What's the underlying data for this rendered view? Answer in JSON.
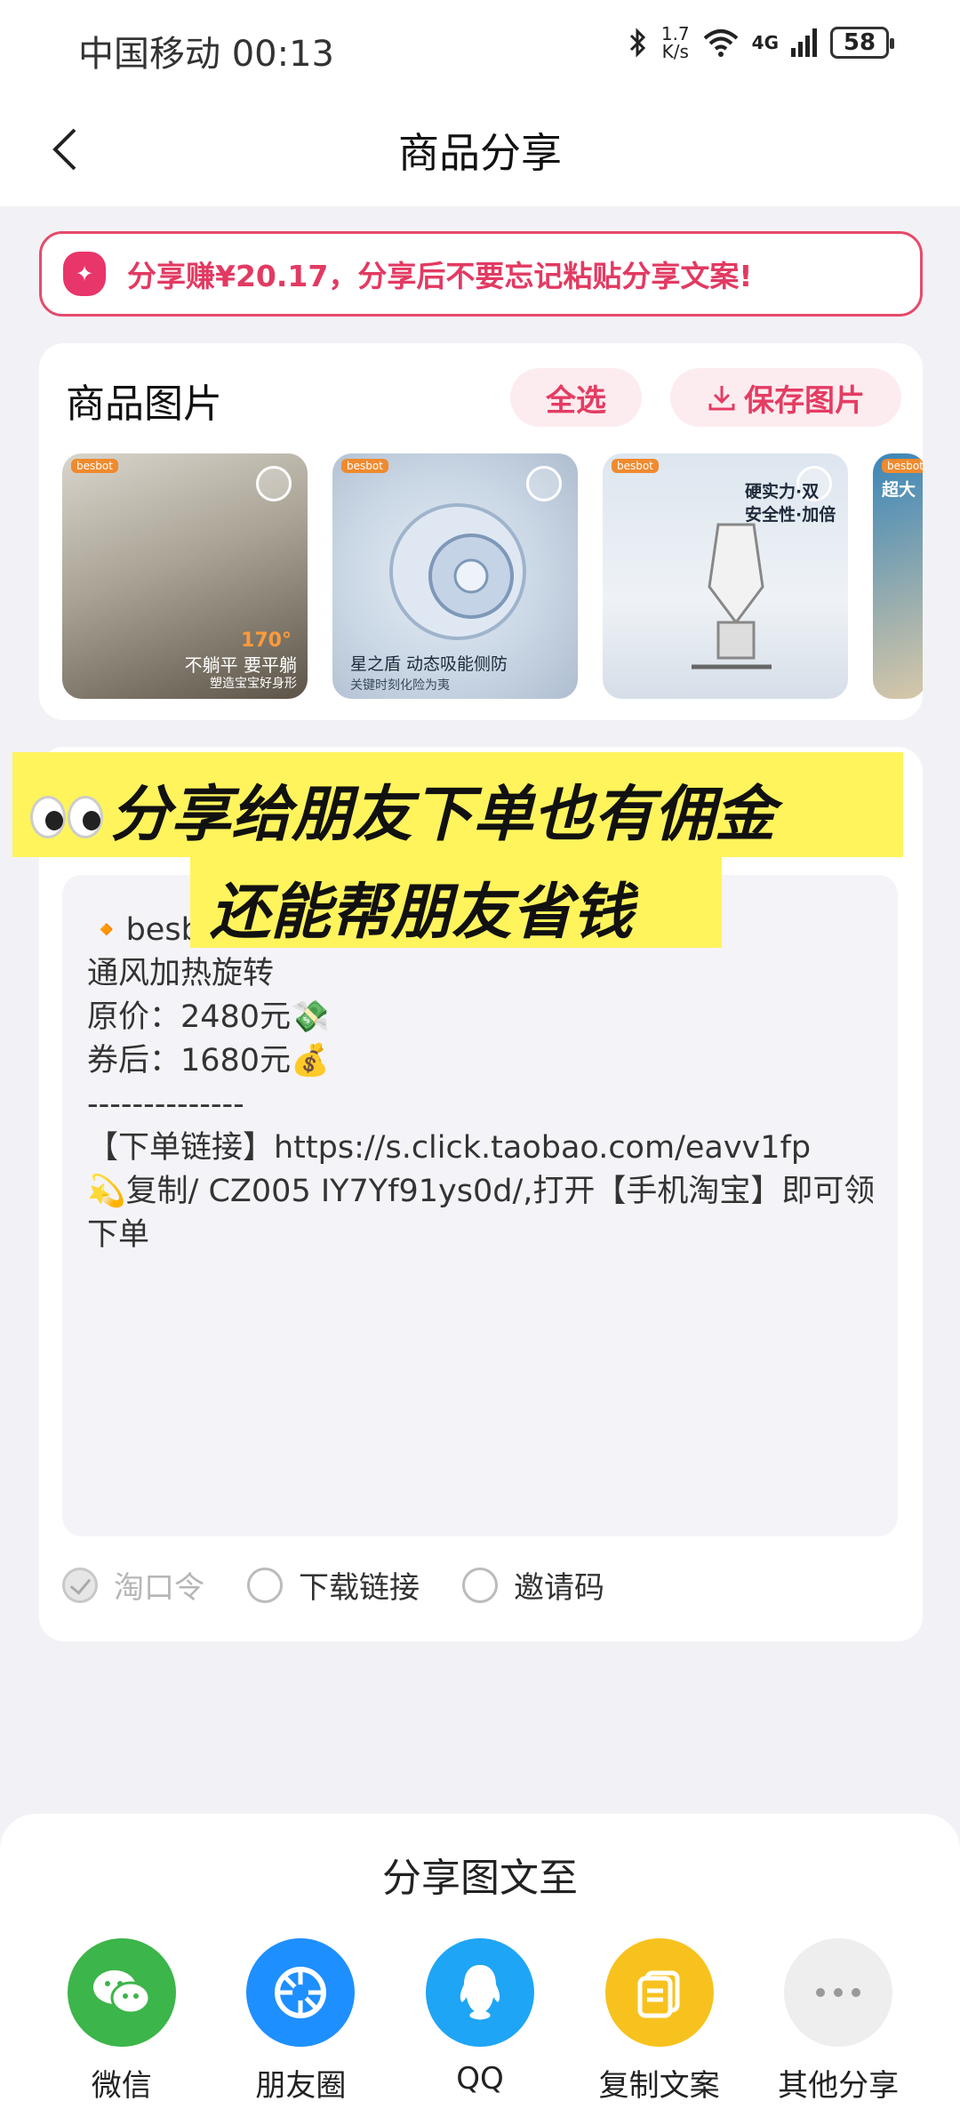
{
  "status_bar": {
    "carrier_time": "中国移动 00:13",
    "speed_top": "1.7",
    "speed_bottom": "K/s",
    "network": "4G",
    "battery": "58"
  },
  "nav": {
    "title": "商品分享"
  },
  "banner": {
    "text": "分享赚¥20.17，分享后不要忘记粘贴分享文案!"
  },
  "images_section": {
    "title": "商品图片",
    "select_all": "全选",
    "save_images": "保存图片",
    "thumbs": [
      {
        "brand": "besbot",
        "caption_line1": "不躺平 要平躺",
        "caption_line2": "塑造宝宝好身形",
        "badge": "170°"
      },
      {
        "brand": "besbot",
        "caption_line1": "星之盾  动态吸能侧防",
        "caption_line2": "关键时刻化险为夷"
      },
      {
        "brand": "besbot",
        "caption_line1": "硬实力·双",
        "caption_line2": "安全性·加倍"
      },
      {
        "brand": "besbot",
        "caption_line1": "超大"
      }
    ]
  },
  "overlay": {
    "line1": "分享给朋友下单也有佣金",
    "line2": "还能帮朋友省钱"
  },
  "copy_text": {
    "lines": [
      "🔸besb                                                宝宝车载",
      "通风加热旋转",
      "原价：2480元💸",
      "券后：1680元💰",
      "--------------",
      "【下单链接】https://s.click.taobao.com/eavv1fp",
      "💫复制/ CZ005 IY7Yf91ys0d/,打开【手机淘宝】即可领券",
      "下单"
    ]
  },
  "options": [
    {
      "label": "淘口令",
      "checked": true,
      "disabled": true
    },
    {
      "label": "下载链接",
      "checked": false
    },
    {
      "label": "邀请码",
      "checked": false
    }
  ],
  "share_sheet": {
    "title": "分享图文至",
    "targets": [
      {
        "label": "微信",
        "icon": "wechat-icon",
        "color": "#3cb54a"
      },
      {
        "label": "朋友圈",
        "icon": "moments-icon",
        "color": "#1e8fff"
      },
      {
        "label": "QQ",
        "icon": "qq-icon",
        "color": "#1ea5f5"
      },
      {
        "label": "复制文案",
        "icon": "copy-icon",
        "color": "#f7c21e"
      },
      {
        "label": "其他分享",
        "icon": "more-icon",
        "color": "#eeeeee"
      }
    ]
  }
}
